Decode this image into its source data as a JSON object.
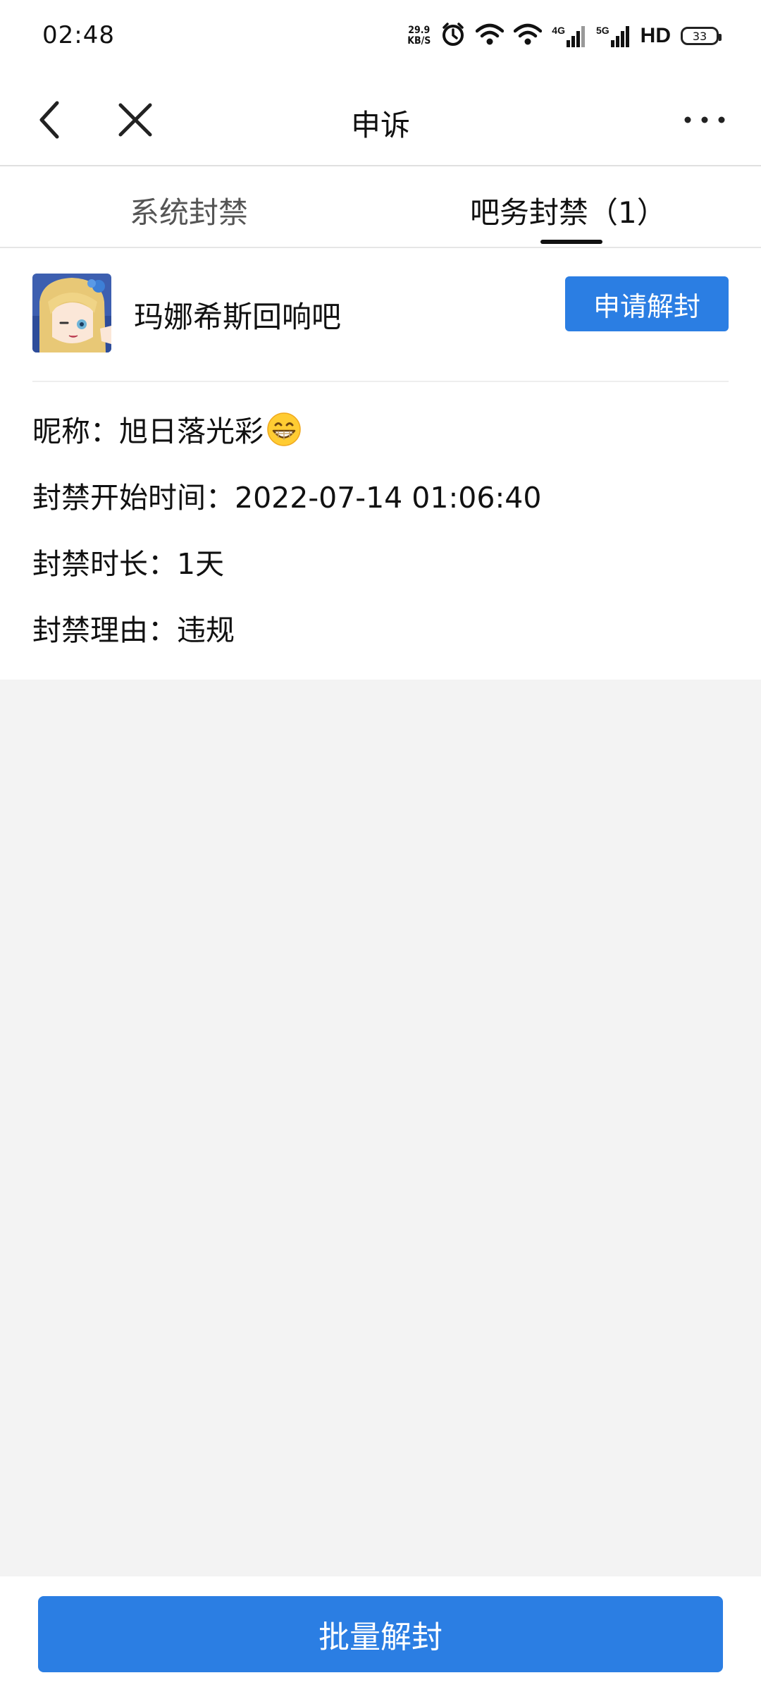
{
  "status_bar": {
    "time": "02:48",
    "net_speed_value": "29.9",
    "net_speed_unit": "KB/S",
    "alarm_icon": "alarm-icon",
    "wifi_icon": "wifi-icon",
    "signal_4g_label": "4G",
    "signal_5g_label": "5G",
    "hd_label": "HD",
    "battery_level": "33"
  },
  "nav": {
    "title": "申诉",
    "back_icon": "chevron-left-icon",
    "close_icon": "close-icon",
    "more_icon": "more-icon"
  },
  "tabs": [
    {
      "label": "系统封禁",
      "active": false
    },
    {
      "label": "吧务封禁（1）",
      "active": true
    }
  ],
  "ban_record": {
    "forum_name": "玛娜希斯回响吧",
    "unban_button": "申请解封",
    "nickname_line": "昵称：旭日落光彩",
    "nickname_emoji_icon": "grinning-emoji-icon",
    "start_time_line": "封禁开始时间：2022-07-14 01:06:40",
    "duration_line": "封禁时长：1天",
    "reason_line": "封禁理由：违规"
  },
  "bottom": {
    "batch_unban_button": "批量解封"
  },
  "colors": {
    "accent": "#2b7ee3",
    "background": "#f3f3f3"
  }
}
